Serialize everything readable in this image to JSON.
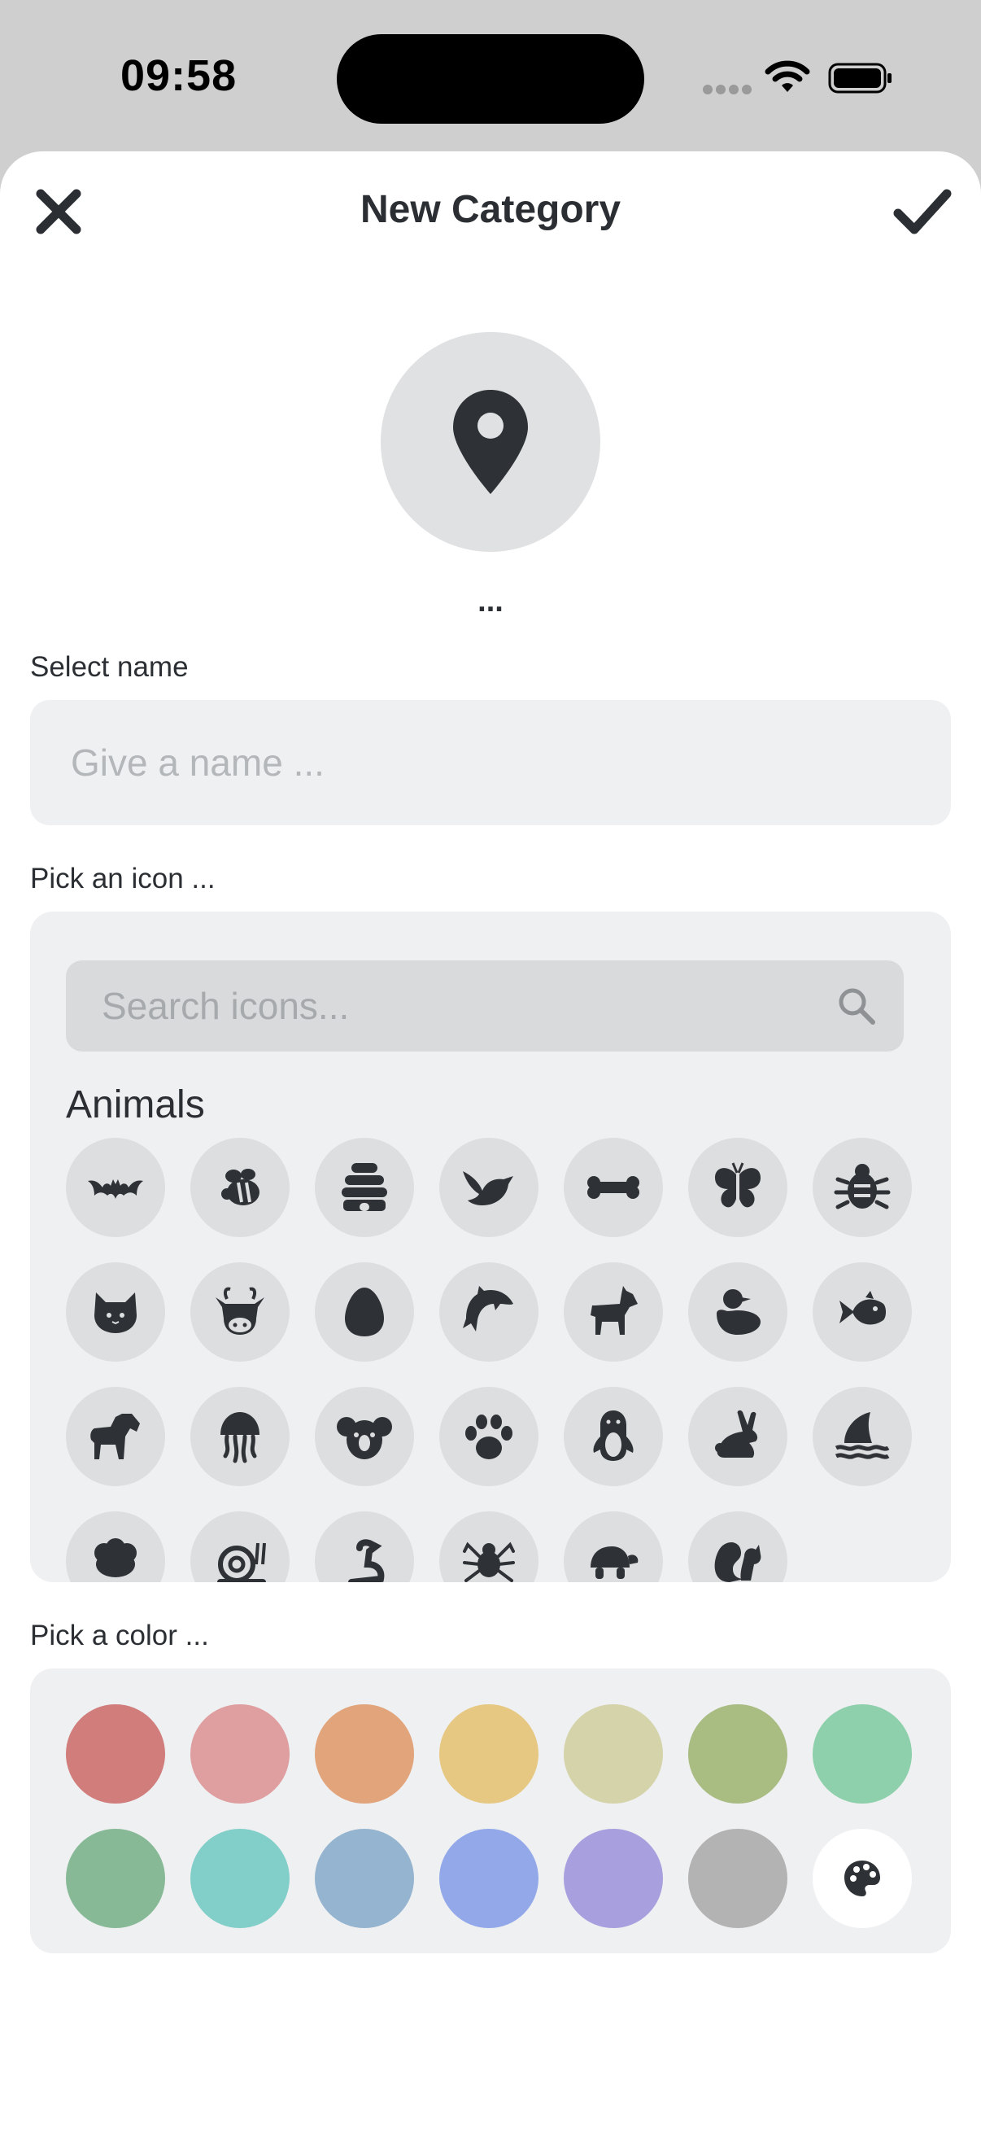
{
  "status_bar": {
    "time": "09:58"
  },
  "header": {
    "title": "New Category",
    "close_icon": "close-icon",
    "confirm_icon": "check-icon"
  },
  "preview": {
    "icon": "map-marker-icon",
    "name": "..."
  },
  "name_section": {
    "label": "Select name",
    "placeholder": "Give a name ..."
  },
  "icon_section": {
    "label": "Pick an icon ...",
    "search_placeholder": "Search icons...",
    "category": "Animals",
    "icons": [
      "bat",
      "bee",
      "beehive",
      "bird",
      "bone",
      "butterfly",
      "bug",
      "cat",
      "cow",
      "egg",
      "dolphin",
      "dog",
      "duck",
      "fish",
      "horse",
      "jellyfish",
      "koala",
      "paw",
      "penguin",
      "rabbit",
      "shark-fin",
      "sheep",
      "snail",
      "snake",
      "spider",
      "turtle",
      "squirrel"
    ]
  },
  "color_section": {
    "label": "Pick a color ...",
    "colors": [
      "#d07d7c",
      "#df9fa0",
      "#e2a47b",
      "#e6c882",
      "#d5d3a9",
      "#a9bc82",
      "#8ed0ab",
      "#87b997",
      "#82cfc9",
      "#95b4cf",
      "#92a8e9",
      "#a8a0de",
      "#b3b3b3"
    ],
    "custom_icon": "palette-icon",
    "custom_bg": "#ffffff"
  }
}
